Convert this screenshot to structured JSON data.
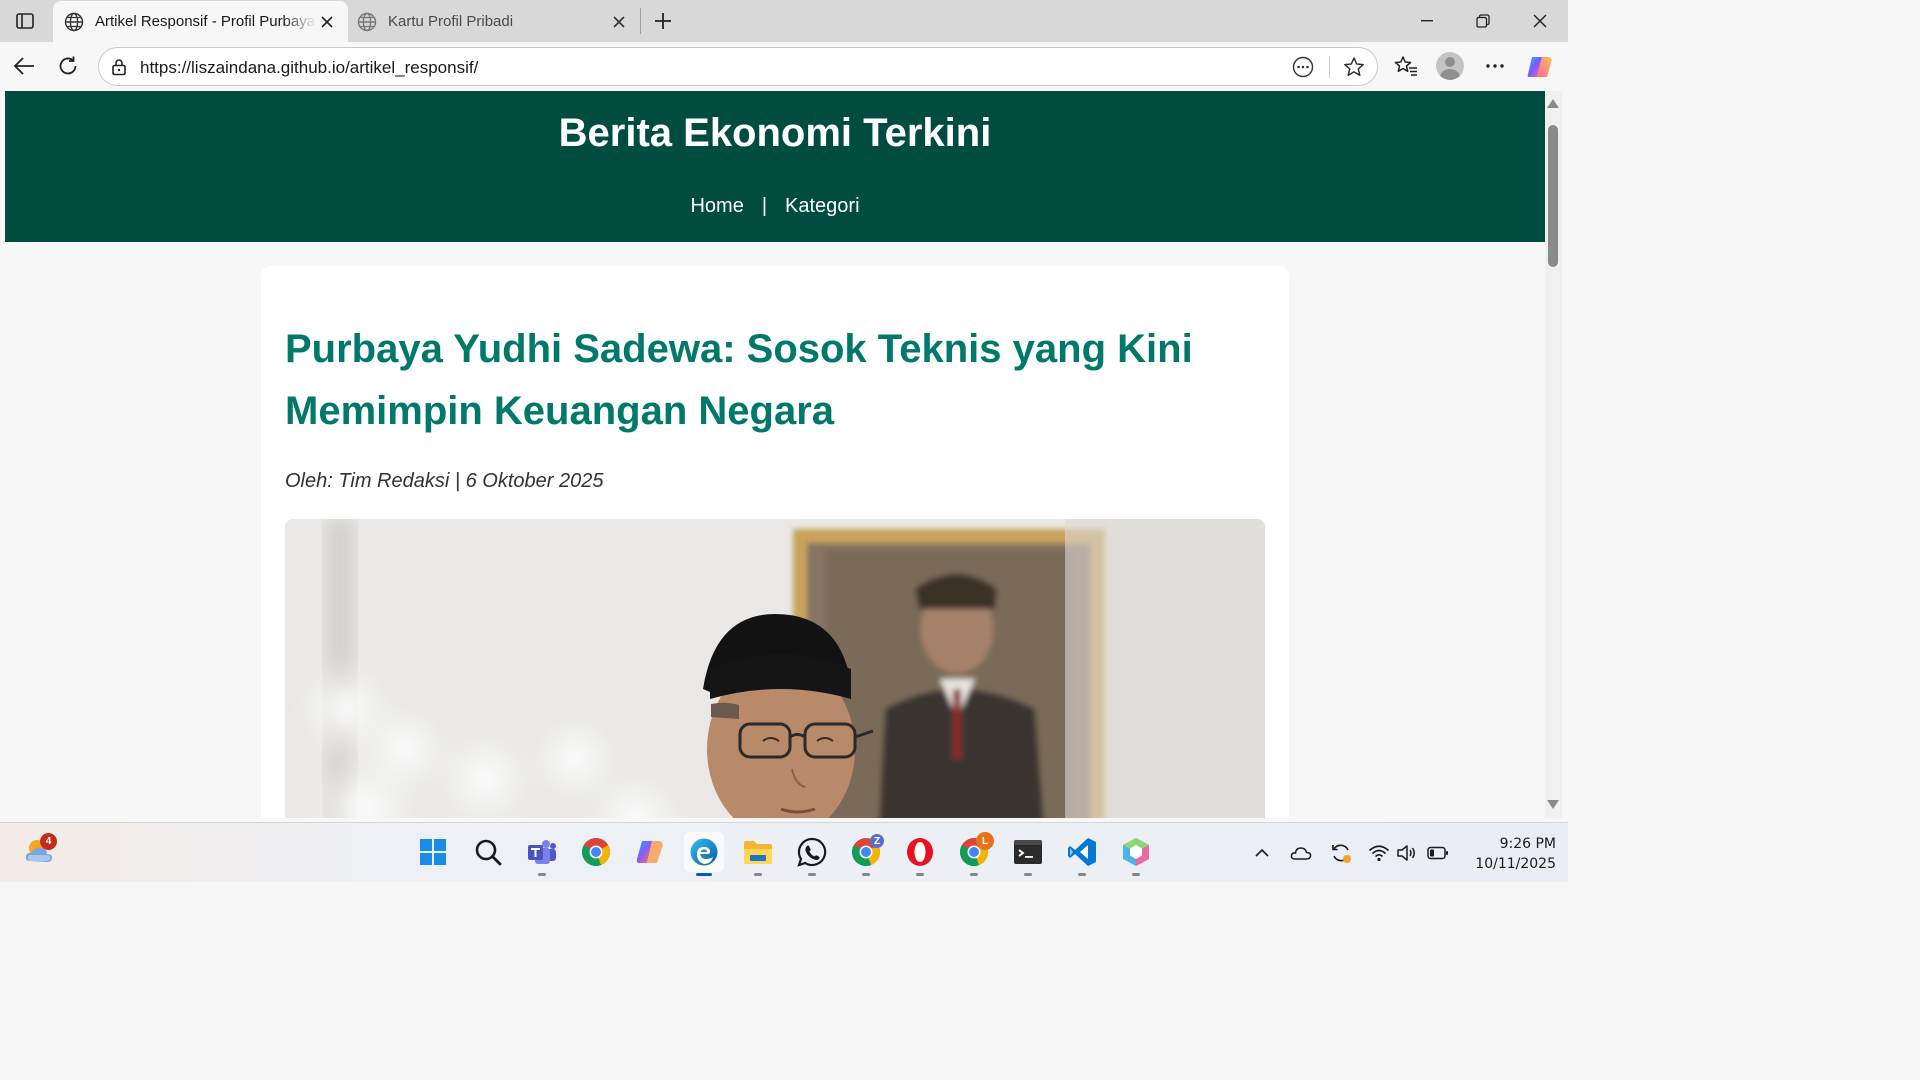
{
  "browser": {
    "tabs": [
      {
        "title": "Artikel Responsif - Profil Purbaya",
        "active": true
      },
      {
        "title": "Kartu Profil Pribadi",
        "active": false
      }
    ],
    "url": "https://liszaindana.github.io/artikel_responsif/"
  },
  "page": {
    "site_title": "Berita Ekonomi Terkini",
    "nav": {
      "home": "Home",
      "separator": "|",
      "kategori": "Kategori"
    },
    "article": {
      "title": "Purbaya Yudhi Sadewa: Sosok Teknis yang Kini Memimpin Keuangan Negara",
      "byline": "Oleh: Tim Redaksi | 6 Oktober 2025"
    },
    "colors": {
      "header_bg": "#004d40",
      "title": "#00796b"
    }
  },
  "taskbar": {
    "weather_badge": "4",
    "apps": [
      "start",
      "search",
      "teams",
      "chrome",
      "copilot",
      "edge",
      "file-explorer",
      "whatsapp",
      "chrome-profile-z",
      "opera",
      "chrome-profile-l",
      "terminal",
      "vscode",
      "app"
    ],
    "chrome_badges": {
      "z": "Z",
      "l": "L"
    },
    "clock": {
      "time": "9:26 PM",
      "date": "10/11/2025"
    }
  }
}
